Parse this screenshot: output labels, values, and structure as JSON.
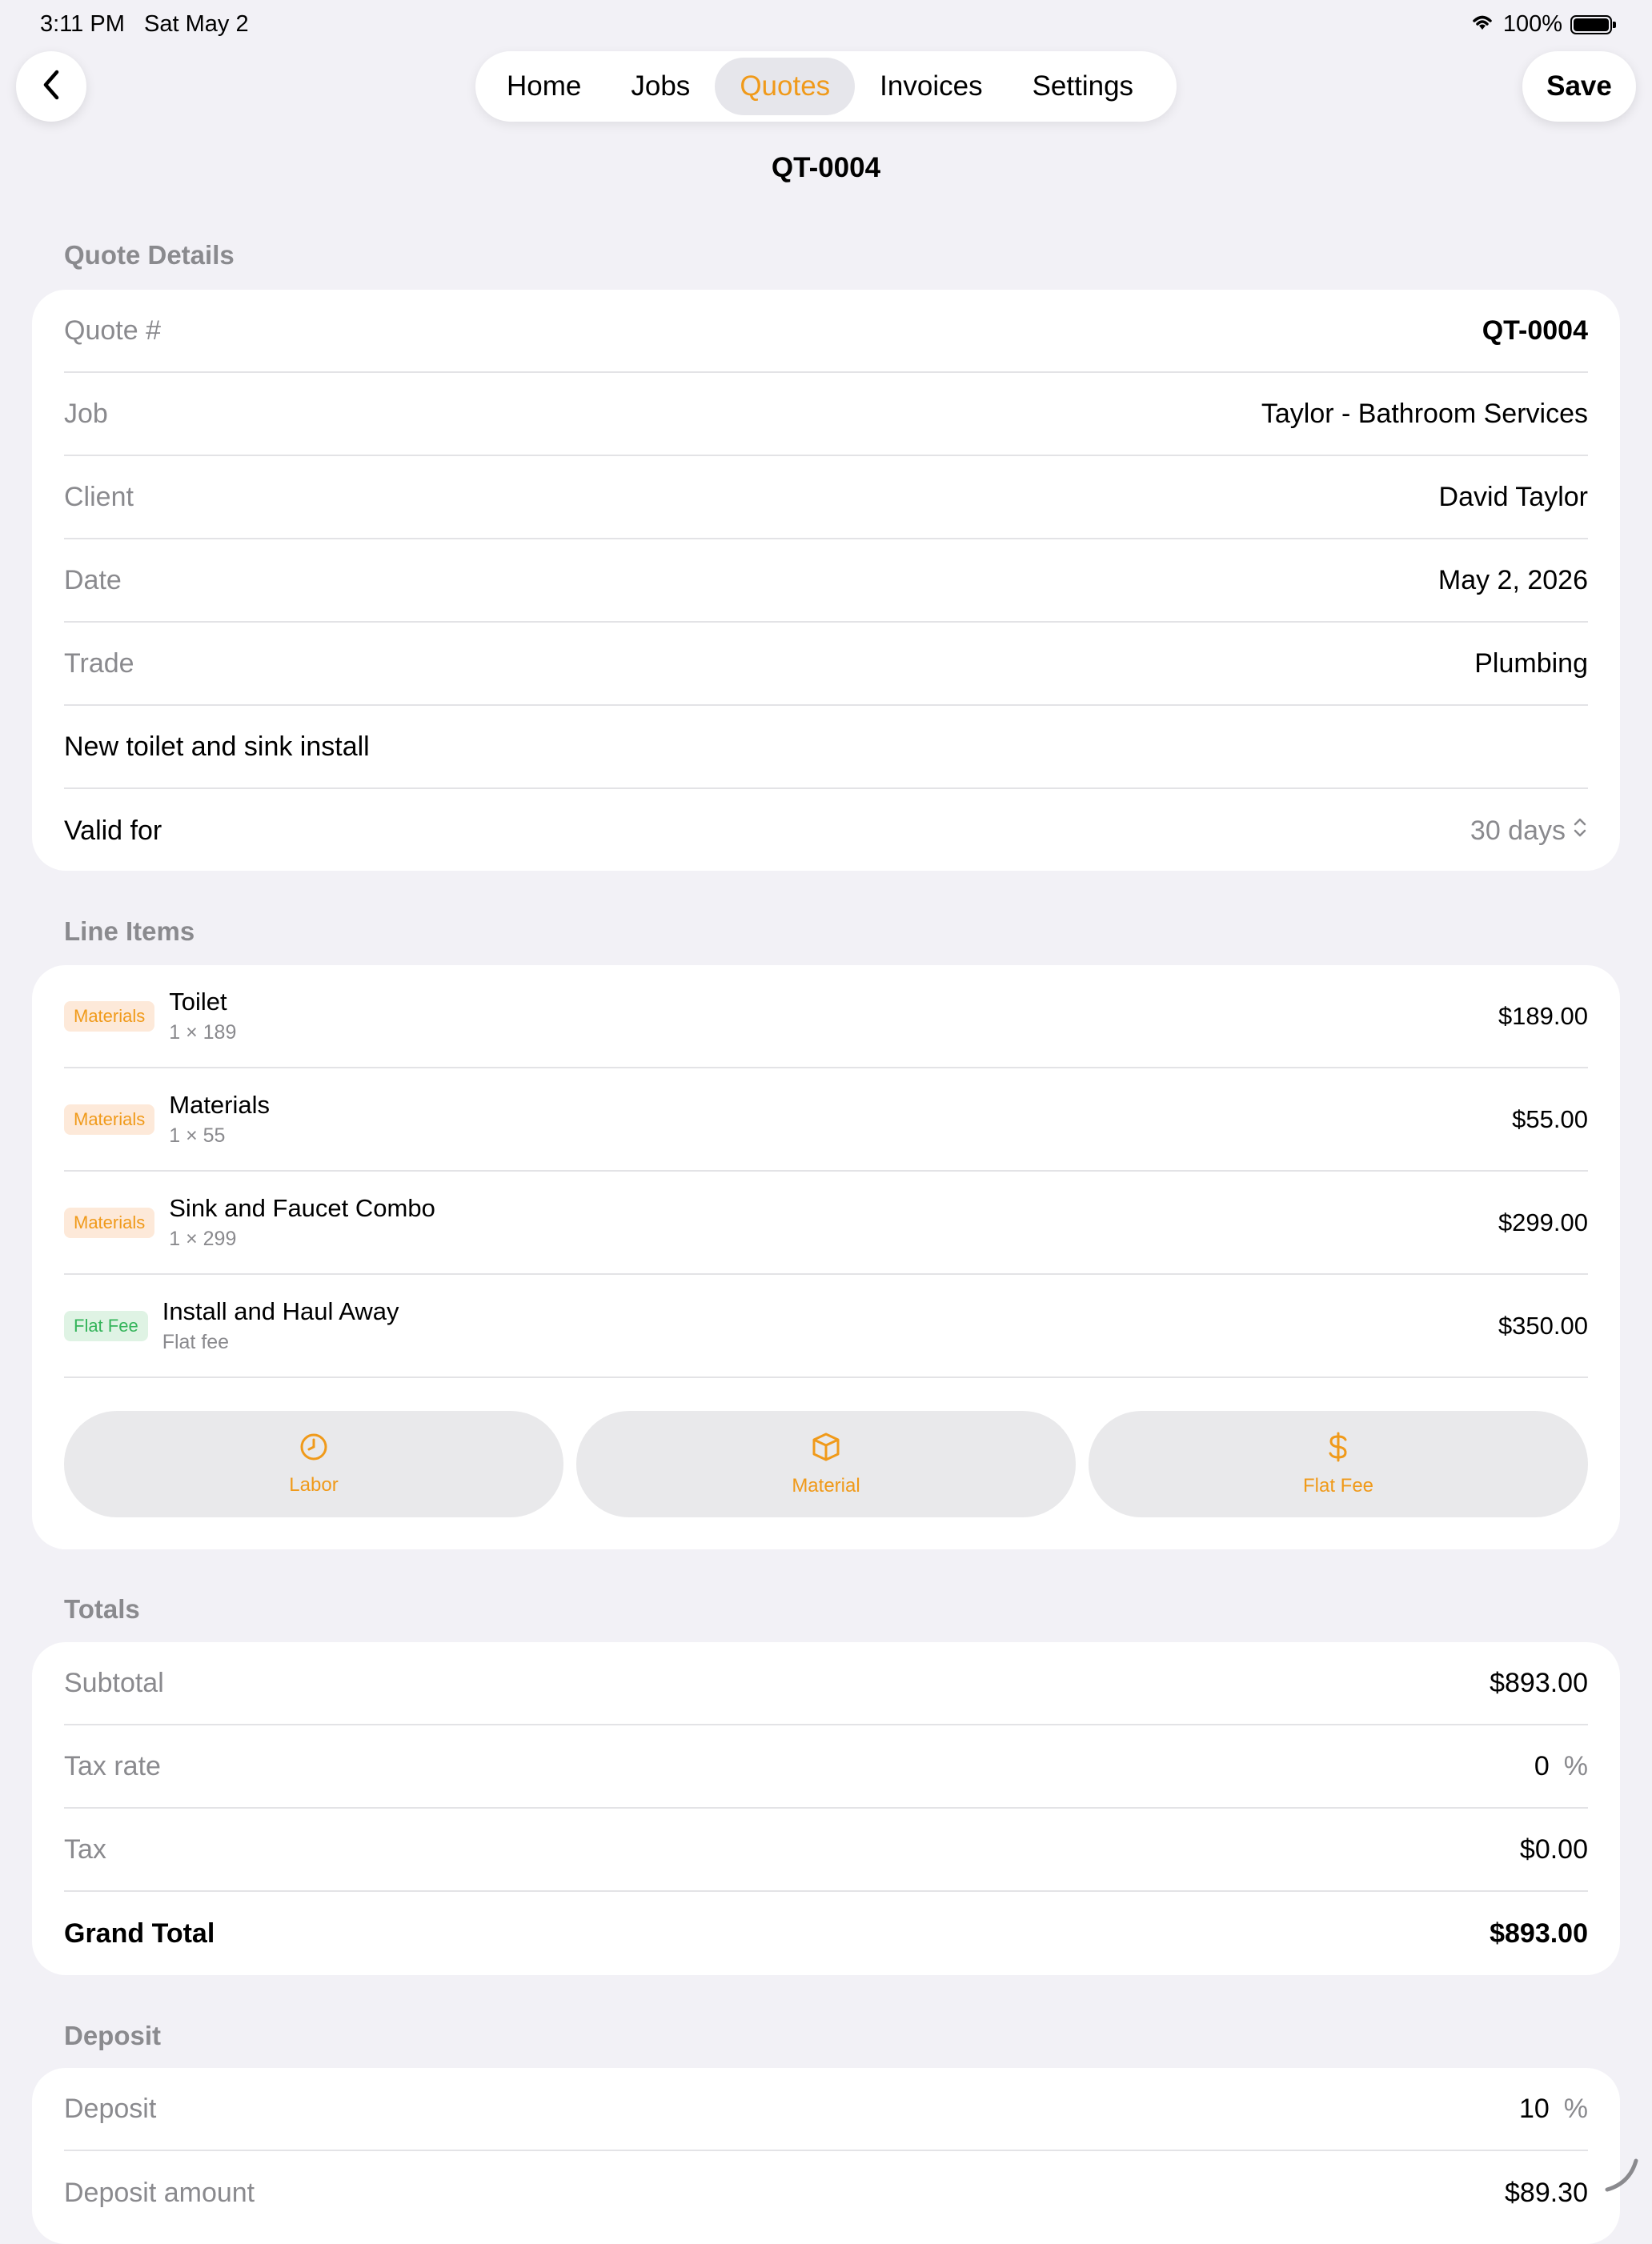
{
  "status_bar": {
    "time": "3:11 PM",
    "date": "Sat May 2",
    "battery": "100%"
  },
  "nav": {
    "tabs": [
      {
        "label": "Home",
        "active": false
      },
      {
        "label": "Jobs",
        "active": false
      },
      {
        "label": "Quotes",
        "active": true
      },
      {
        "label": "Invoices",
        "active": false
      },
      {
        "label": "Settings",
        "active": false
      }
    ],
    "save_label": "Save"
  },
  "page_title": "QT-0004",
  "quote_details": {
    "header": "Quote Details",
    "rows": [
      {
        "label": "Quote #",
        "value": "QT-0004"
      },
      {
        "label": "Job",
        "value": "Taylor - Bathroom Services"
      },
      {
        "label": "Client",
        "value": "David Taylor"
      },
      {
        "label": "Date",
        "value": "May 2, 2026"
      },
      {
        "label": "Trade",
        "value": "Plumbing"
      }
    ],
    "description": "New toilet and sink install",
    "valid_for_label": "Valid for",
    "valid_for_value": "30 days"
  },
  "line_items": {
    "header": "Line Items",
    "items": [
      {
        "badge": "Materials",
        "name": "Toilet",
        "sub": "1 × 189",
        "price": "$189.00"
      },
      {
        "badge": "Materials",
        "name": "Materials",
        "sub": "1 × 55",
        "price": "$55.00"
      },
      {
        "badge": "Materials",
        "name": "Sink and Faucet Combo",
        "sub": "1 × 299",
        "price": "$299.00"
      },
      {
        "badge": "Flat Fee",
        "name": "Install and Haul Away",
        "sub": "Flat fee",
        "price": "$350.00"
      }
    ],
    "add_buttons": [
      {
        "label": "Labor",
        "icon": "clock-icon"
      },
      {
        "label": "Material",
        "icon": "box-icon"
      },
      {
        "label": "Flat Fee",
        "icon": "dollar-icon"
      }
    ]
  },
  "totals": {
    "header": "Totals",
    "subtotal_label": "Subtotal",
    "subtotal": "$893.00",
    "tax_rate_label": "Tax rate",
    "tax_rate": "0",
    "tax_rate_unit": "%",
    "tax_label": "Tax",
    "tax": "$0.00",
    "grand_total_label": "Grand Total",
    "grand_total": "$893.00"
  },
  "deposit": {
    "header": "Deposit",
    "deposit_label": "Deposit",
    "deposit_value": "10",
    "deposit_unit": "%",
    "amount_label": "Deposit amount",
    "amount": "$89.30"
  },
  "colors": {
    "accent": "#f09a1a",
    "background": "#f2f1f6",
    "flat_fee_green": "#34b45a"
  }
}
